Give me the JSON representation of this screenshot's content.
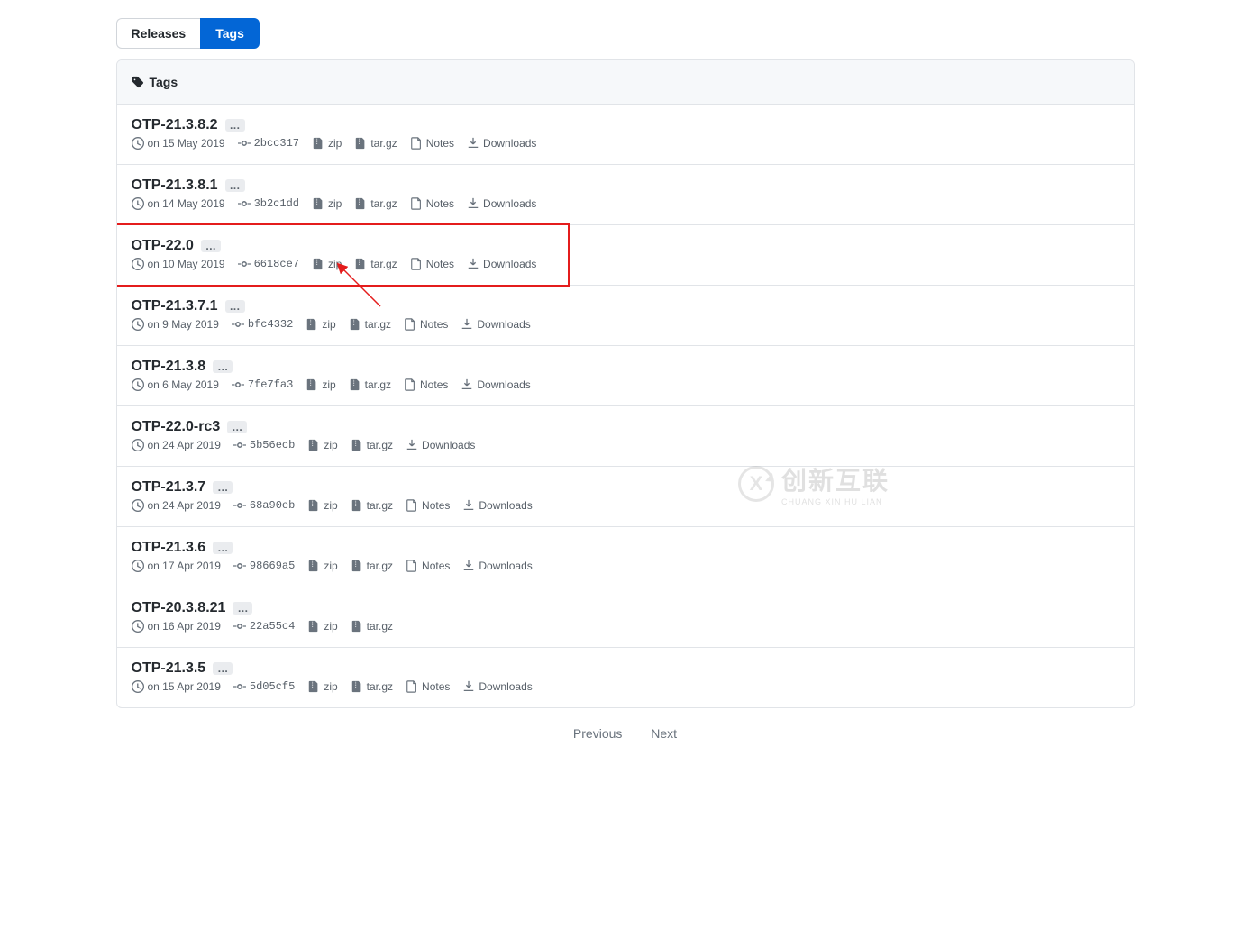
{
  "tabs": {
    "releases": "Releases",
    "tags": "Tags"
  },
  "panel_header": "Tags",
  "labels": {
    "zip": "zip",
    "targz": "tar.gz",
    "notes": "Notes",
    "downloads": "Downloads",
    "ellipsis": "…"
  },
  "pagination": {
    "prev": "Previous",
    "next": "Next"
  },
  "watermark": {
    "big": "创新互联",
    "small": "CHUANG XIN HU LIAN",
    "logo_letter": "X"
  },
  "tags": [
    {
      "name": "OTP-21.3.8.2",
      "date": "on 15 May 2019",
      "sha": "2bcc317",
      "hasNotes": true,
      "hasDownloads": true
    },
    {
      "name": "OTP-21.3.8.1",
      "date": "on 14 May 2019",
      "sha": "3b2c1dd",
      "hasNotes": true,
      "hasDownloads": true
    },
    {
      "name": "OTP-22.0",
      "date": "on 10 May 2019",
      "sha": "6618ce7",
      "hasNotes": true,
      "hasDownloads": true,
      "highlight": true
    },
    {
      "name": "OTP-21.3.7.1",
      "date": "on 9 May 2019",
      "sha": "bfc4332",
      "hasNotes": true,
      "hasDownloads": true
    },
    {
      "name": "OTP-21.3.8",
      "date": "on 6 May 2019",
      "sha": "7fe7fa3",
      "hasNotes": true,
      "hasDownloads": true
    },
    {
      "name": "OTP-22.0-rc3",
      "date": "on 24 Apr 2019",
      "sha": "5b56ecb",
      "hasNotes": false,
      "hasDownloads": true
    },
    {
      "name": "OTP-21.3.7",
      "date": "on 24 Apr 2019",
      "sha": "68a90eb",
      "hasNotes": true,
      "hasDownloads": true
    },
    {
      "name": "OTP-21.3.6",
      "date": "on 17 Apr 2019",
      "sha": "98669a5",
      "hasNotes": true,
      "hasDownloads": true
    },
    {
      "name": "OTP-20.3.8.21",
      "date": "on 16 Apr 2019",
      "sha": "22a55c4",
      "hasNotes": false,
      "hasDownloads": false
    },
    {
      "name": "OTP-21.3.5",
      "date": "on 15 Apr 2019",
      "sha": "5d05cf5",
      "hasNotes": true,
      "hasDownloads": true
    }
  ]
}
